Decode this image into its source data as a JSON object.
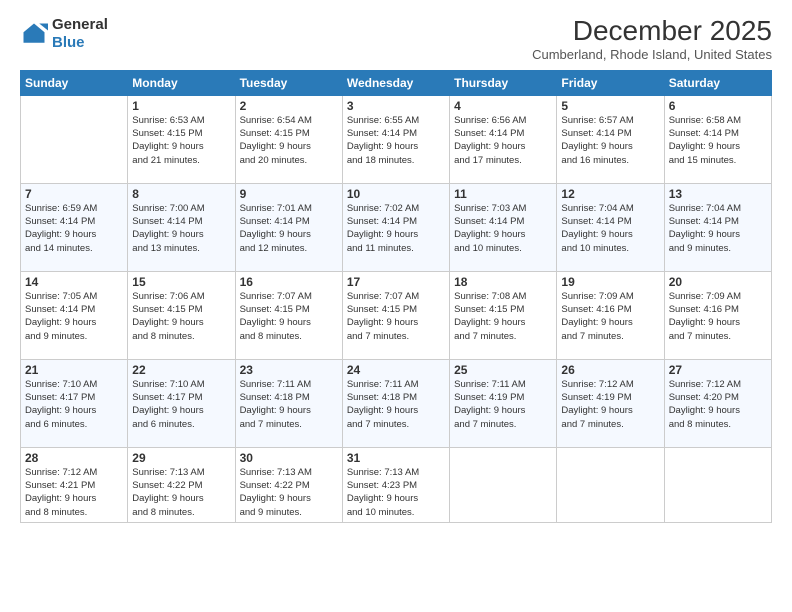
{
  "logo": {
    "general": "General",
    "blue": "Blue"
  },
  "title": "December 2025",
  "location": "Cumberland, Rhode Island, United States",
  "weekdays": [
    "Sunday",
    "Monday",
    "Tuesday",
    "Wednesday",
    "Thursday",
    "Friday",
    "Saturday"
  ],
  "weeks": [
    [
      {
        "day": "",
        "info": ""
      },
      {
        "day": "1",
        "info": "Sunrise: 6:53 AM\nSunset: 4:15 PM\nDaylight: 9 hours\nand 21 minutes."
      },
      {
        "day": "2",
        "info": "Sunrise: 6:54 AM\nSunset: 4:15 PM\nDaylight: 9 hours\nand 20 minutes."
      },
      {
        "day": "3",
        "info": "Sunrise: 6:55 AM\nSunset: 4:14 PM\nDaylight: 9 hours\nand 18 minutes."
      },
      {
        "day": "4",
        "info": "Sunrise: 6:56 AM\nSunset: 4:14 PM\nDaylight: 9 hours\nand 17 minutes."
      },
      {
        "day": "5",
        "info": "Sunrise: 6:57 AM\nSunset: 4:14 PM\nDaylight: 9 hours\nand 16 minutes."
      },
      {
        "day": "6",
        "info": "Sunrise: 6:58 AM\nSunset: 4:14 PM\nDaylight: 9 hours\nand 15 minutes."
      }
    ],
    [
      {
        "day": "7",
        "info": "Sunrise: 6:59 AM\nSunset: 4:14 PM\nDaylight: 9 hours\nand 14 minutes."
      },
      {
        "day": "8",
        "info": "Sunrise: 7:00 AM\nSunset: 4:14 PM\nDaylight: 9 hours\nand 13 minutes."
      },
      {
        "day": "9",
        "info": "Sunrise: 7:01 AM\nSunset: 4:14 PM\nDaylight: 9 hours\nand 12 minutes."
      },
      {
        "day": "10",
        "info": "Sunrise: 7:02 AM\nSunset: 4:14 PM\nDaylight: 9 hours\nand 11 minutes."
      },
      {
        "day": "11",
        "info": "Sunrise: 7:03 AM\nSunset: 4:14 PM\nDaylight: 9 hours\nand 10 minutes."
      },
      {
        "day": "12",
        "info": "Sunrise: 7:04 AM\nSunset: 4:14 PM\nDaylight: 9 hours\nand 10 minutes."
      },
      {
        "day": "13",
        "info": "Sunrise: 7:04 AM\nSunset: 4:14 PM\nDaylight: 9 hours\nand 9 minutes."
      }
    ],
    [
      {
        "day": "14",
        "info": "Sunrise: 7:05 AM\nSunset: 4:14 PM\nDaylight: 9 hours\nand 9 minutes."
      },
      {
        "day": "15",
        "info": "Sunrise: 7:06 AM\nSunset: 4:15 PM\nDaylight: 9 hours\nand 8 minutes."
      },
      {
        "day": "16",
        "info": "Sunrise: 7:07 AM\nSunset: 4:15 PM\nDaylight: 9 hours\nand 8 minutes."
      },
      {
        "day": "17",
        "info": "Sunrise: 7:07 AM\nSunset: 4:15 PM\nDaylight: 9 hours\nand 7 minutes."
      },
      {
        "day": "18",
        "info": "Sunrise: 7:08 AM\nSunset: 4:15 PM\nDaylight: 9 hours\nand 7 minutes."
      },
      {
        "day": "19",
        "info": "Sunrise: 7:09 AM\nSunset: 4:16 PM\nDaylight: 9 hours\nand 7 minutes."
      },
      {
        "day": "20",
        "info": "Sunrise: 7:09 AM\nSunset: 4:16 PM\nDaylight: 9 hours\nand 7 minutes."
      }
    ],
    [
      {
        "day": "21",
        "info": "Sunrise: 7:10 AM\nSunset: 4:17 PM\nDaylight: 9 hours\nand 6 minutes."
      },
      {
        "day": "22",
        "info": "Sunrise: 7:10 AM\nSunset: 4:17 PM\nDaylight: 9 hours\nand 6 minutes."
      },
      {
        "day": "23",
        "info": "Sunrise: 7:11 AM\nSunset: 4:18 PM\nDaylight: 9 hours\nand 7 minutes."
      },
      {
        "day": "24",
        "info": "Sunrise: 7:11 AM\nSunset: 4:18 PM\nDaylight: 9 hours\nand 7 minutes."
      },
      {
        "day": "25",
        "info": "Sunrise: 7:11 AM\nSunset: 4:19 PM\nDaylight: 9 hours\nand 7 minutes."
      },
      {
        "day": "26",
        "info": "Sunrise: 7:12 AM\nSunset: 4:19 PM\nDaylight: 9 hours\nand 7 minutes."
      },
      {
        "day": "27",
        "info": "Sunrise: 7:12 AM\nSunset: 4:20 PM\nDaylight: 9 hours\nand 8 minutes."
      }
    ],
    [
      {
        "day": "28",
        "info": "Sunrise: 7:12 AM\nSunset: 4:21 PM\nDaylight: 9 hours\nand 8 minutes."
      },
      {
        "day": "29",
        "info": "Sunrise: 7:13 AM\nSunset: 4:22 PM\nDaylight: 9 hours\nand 8 minutes."
      },
      {
        "day": "30",
        "info": "Sunrise: 7:13 AM\nSunset: 4:22 PM\nDaylight: 9 hours\nand 9 minutes."
      },
      {
        "day": "31",
        "info": "Sunrise: 7:13 AM\nSunset: 4:23 PM\nDaylight: 9 hours\nand 10 minutes."
      },
      {
        "day": "",
        "info": ""
      },
      {
        "day": "",
        "info": ""
      },
      {
        "day": "",
        "info": ""
      }
    ]
  ]
}
